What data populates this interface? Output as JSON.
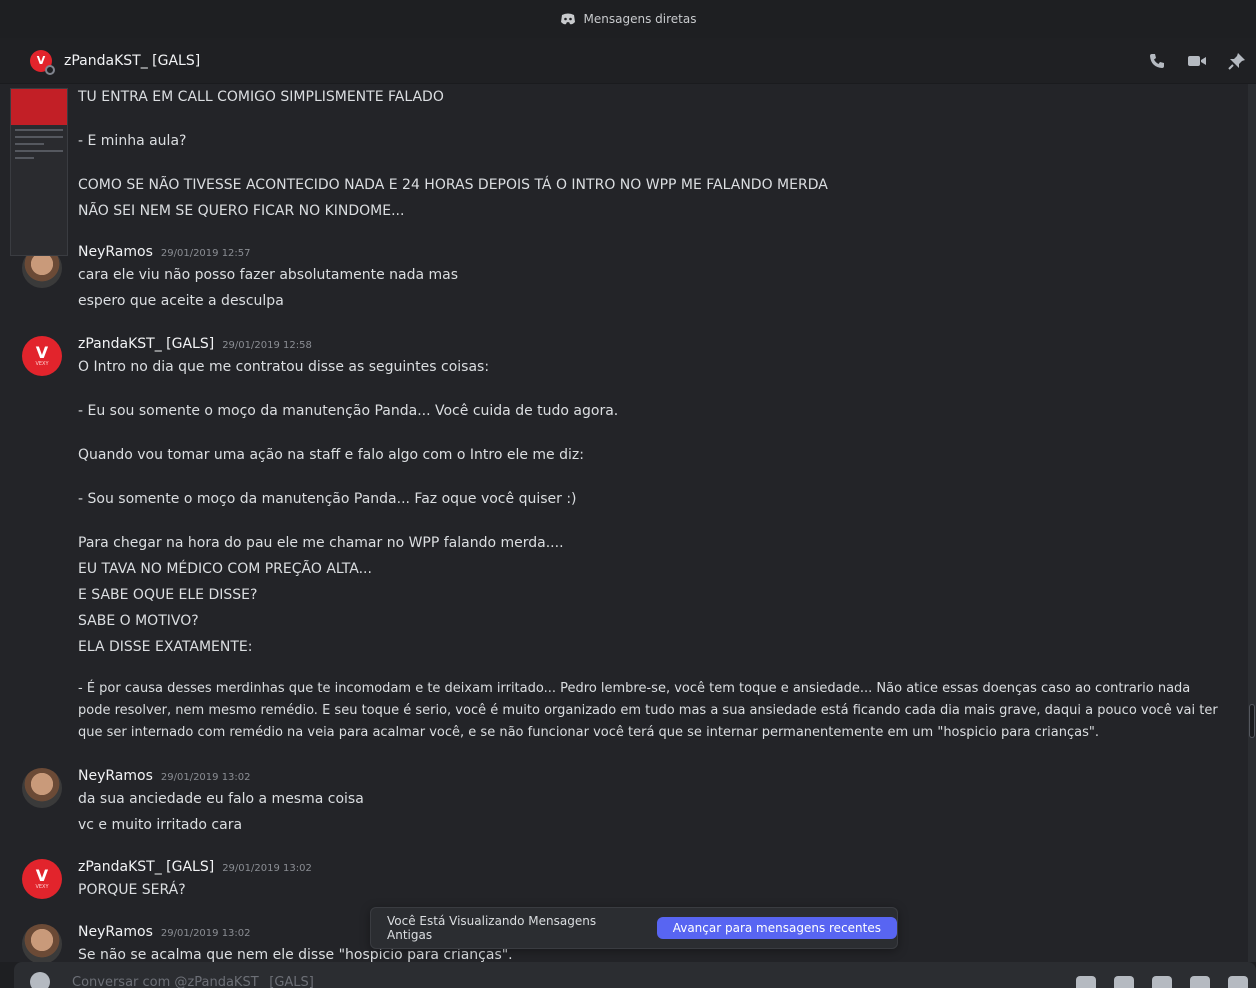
{
  "window": {
    "title": "Mensagens diretas"
  },
  "header": {
    "channel_name": "zPandaKST_ [GALS]"
  },
  "messages": {
    "continuation": [
      "TU ENTRA EM CALL COMIGO SIMPLISMENTE FALADO",
      "- E minha aula?",
      "COMO SE NÃO TIVESSE ACONTECIDO NADA E 24 HORAS DEPOIS TÁ O INTRO NO WPP ME FALANDO MERDA",
      "NÃO SEI NEM SE QUERO FICAR NO KINDOME..."
    ],
    "groups": [
      {
        "username": "NeyRamos",
        "timestamp": "29/01/2019 12:57",
        "lines": [
          "cara ele viu não posso fazer absolutamente nada mas",
          "espero que aceite a desculpa"
        ]
      },
      {
        "username": "zPandaKST_ [GALS]",
        "timestamp": "29/01/2019 12:58",
        "lines": [
          "O Intro no dia que me contratou disse as seguintes coisas:",
          "- Eu sou somente o moço da manutenção Panda... Você cuida de tudo agora.",
          "Quando vou tomar uma ação na staff e falo algo com o Intro ele me diz:",
          "- Sou somente o moço da manutenção Panda... Faz oque você quiser :)",
          "Para chegar na hora do pau ele me chamar no WPP falando merda....",
          "EU TAVA NO MÉDICO COM PREÇÃO ALTA...",
          "E SABE OQUE ELE DISSE?",
          "SABE O MOTIVO?",
          "ELA DISSE EXATAMENTE:",
          "- É por causa desses merdinhas que te incomodam e te deixam irritado... Pedro lembre-se, você tem toque e ansiedade... Não atice essas doenças caso ao contrario nada pode resolver, nem mesmo remédio. E seu toque é serio, você é muito organizado em tudo mas a sua ansiedade está ficando cada dia mais grave, daqui a pouco você vai ter que ser internado com remédio na veia para acalmar você, e se não funcionar você terá que se internar permanentemente em um \"hospicio para crianças\"."
        ]
      },
      {
        "username": "NeyRamos",
        "timestamp": "29/01/2019 13:02",
        "lines": [
          "da sua anciedade eu falo a mesma coisa",
          "vc e muito irritado cara"
        ]
      },
      {
        "username": "zPandaKST_ [GALS]",
        "timestamp": "29/01/2019 13:02",
        "lines": [
          "PORQUE SERÁ?"
        ]
      },
      {
        "username": "NeyRamos",
        "timestamp": "29/01/2019 13:02",
        "lines": [
          "Se não se acalma que nem ele disse \"hospicio para crianças\"."
        ]
      }
    ]
  },
  "jump_bar": {
    "text": "Você Está Visualizando Mensagens Antigas",
    "button": "Avançar para mensagens recentes"
  },
  "composer": {
    "placeholder": "Conversar com @zPandaKST_ [GALS]"
  },
  "colors": {
    "accent": "#5865f2",
    "avatar_red": "#e2242c",
    "background": "#232428"
  },
  "icons": [
    "discord-icon",
    "phone-call-icon",
    "video-call-icon",
    "pin-icon",
    "plus-icon",
    "gift-icon",
    "gif-icon",
    "sticker-icon",
    "emoji-icon",
    "apps-icon"
  ]
}
